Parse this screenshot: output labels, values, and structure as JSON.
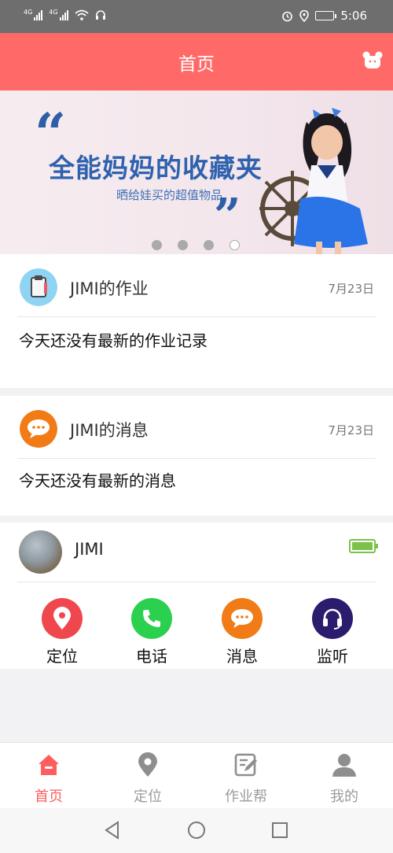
{
  "status_bar": {
    "sim1": "4G",
    "sim2": "4G",
    "time": "5:06"
  },
  "header": {
    "title": "首页",
    "right_icon": "bear-icon"
  },
  "banner": {
    "title": "全能妈妈的收藏夹",
    "subtitle": "晒给娃买的超值物品",
    "page_count": 4,
    "active_index": 3
  },
  "homework_card": {
    "title": "JIMI的作业",
    "date": "7月23日",
    "message": "今天还没有最新的作业记录",
    "icon": "clipboard-icon"
  },
  "message_card": {
    "title": "JIMI的消息",
    "date": "7月23日",
    "message": "今天还没有最新的消息",
    "icon": "chat-bubble-icon"
  },
  "device_card": {
    "name": "JIMI",
    "battery_level": 1.0,
    "actions": [
      {
        "label": "定位",
        "icon": "location-pin-icon",
        "color": "#f0474f"
      },
      {
        "label": "电话",
        "icon": "phone-icon",
        "color": "#2bd04e"
      },
      {
        "label": "消息",
        "icon": "chat-bubble-icon",
        "color": "#f07b17"
      },
      {
        "label": "监听",
        "icon": "headset-icon",
        "color": "#2b1c6e"
      }
    ]
  },
  "bottom_nav": {
    "items": [
      {
        "label": "首页",
        "icon": "home-icon",
        "active": true
      },
      {
        "label": "定位",
        "icon": "location-pin-icon",
        "active": false
      },
      {
        "label": "作业帮",
        "icon": "edit-note-icon",
        "active": false
      },
      {
        "label": "我的",
        "icon": "user-icon",
        "active": false
      }
    ]
  },
  "colors": {
    "header": "#ff6a69",
    "accent": "#ff5e5e"
  }
}
